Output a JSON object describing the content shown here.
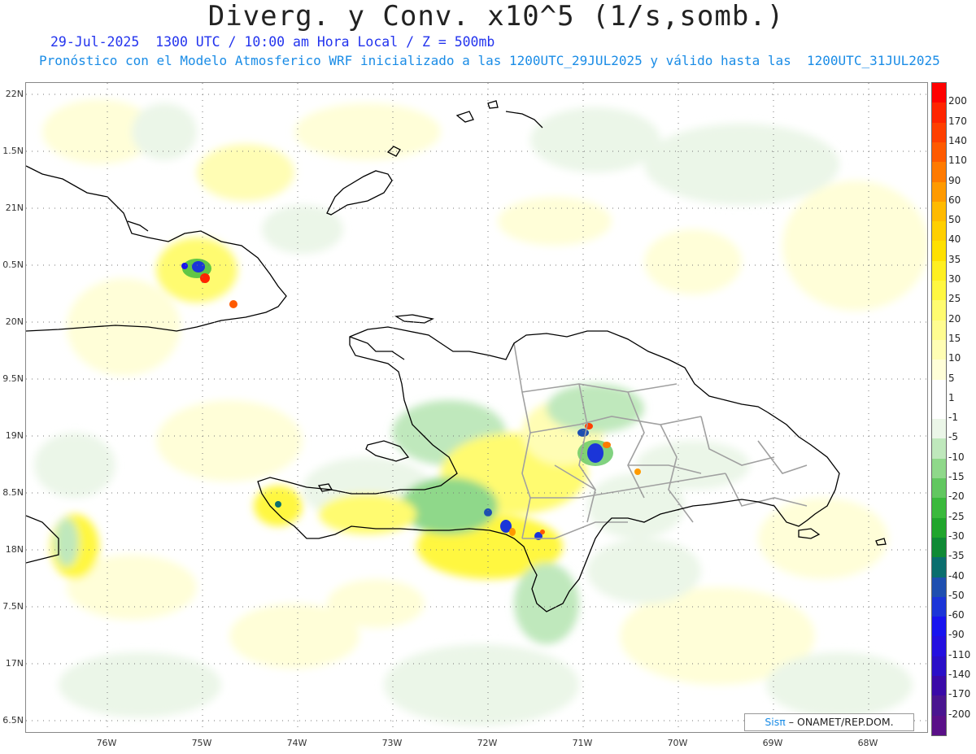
{
  "header": {
    "title": "Diverg. y Conv. x10^5 (1/s,somb.)",
    "subtitle_line1": "29-Jul-2025  1300 UTC / 10:00 am Hora Local / Z = 500mb",
    "subtitle_line2": "Pronóstico con el Modelo Atmosferico WRF inicializado a las 1200UTC_29JUL2025 y válido hasta las  1200UTC_31JUL2025"
  },
  "map": {
    "lat_labels": [
      "22N",
      "1.5N",
      "21N",
      "0.5N",
      "20N",
      "9.5N",
      "19N",
      "8.5N",
      "18N",
      "7.5N",
      "17N",
      "6.5N"
    ],
    "lon_labels": [
      "76W",
      "75W",
      "74W",
      "73W",
      "72W",
      "71W",
      "70W",
      "69W",
      "68W"
    ],
    "colors": {
      "coastline": "#000000",
      "province_border": "#a0a0a0",
      "grid": "#777777"
    }
  },
  "colorbar": {
    "labels": [
      "200",
      "170",
      "140",
      "110",
      "90",
      "60",
      "50",
      "40",
      "35",
      "30",
      "25",
      "20",
      "15",
      "10",
      "5",
      "1",
      "-1",
      "-5",
      "-10",
      "-15",
      "-20",
      "-25",
      "-30",
      "-35",
      "-40",
      "-50",
      "-60",
      "-90",
      "-110",
      "-140",
      "-170",
      "-200"
    ],
    "colors": [
      "#ff0000",
      "#ff2400",
      "#ff3f00",
      "#ff5a00",
      "#ff7a00",
      "#ff9a00",
      "#ffba00",
      "#ffcf00",
      "#ffe000",
      "#ffef20",
      "#fff740",
      "#fffb70",
      "#fffc90",
      "#fffdb4",
      "#fffed8",
      "#ffffff",
      "#ffffff",
      "#ebf6e8",
      "#bfe8bc",
      "#8fd88a",
      "#62c760",
      "#3ab93c",
      "#20a52c",
      "#0f8a35",
      "#0a6e6e",
      "#1e4fb0",
      "#1b35d8",
      "#1814ef",
      "#2410e0",
      "#2a0fc8",
      "#3a0aa8",
      "#4a1590",
      "#5a1088"
    ]
  },
  "credit": {
    "sis": "Sisπ",
    "text": " – ONAMET/REP.DOM."
  }
}
